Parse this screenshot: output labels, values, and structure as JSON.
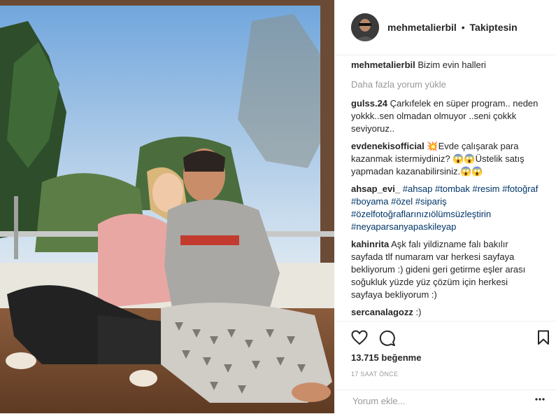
{
  "post": {
    "username": "mehmetalierbil",
    "separator": "•",
    "follow_status": "Takiptesin",
    "caption": "Bizim evin halleri",
    "load_more": "Daha fazla yorum yükle",
    "likes": "13.715 beğenme",
    "time": "17 SAAT ÖNCE",
    "comment_placeholder": "Yorum ekle..."
  },
  "comments": [
    {
      "user": "gulss.24",
      "text": "Çarkıfelek en süper program.. neden yokkk..sen olmadan olmuyor ..seni çokkk seviyoruz.."
    },
    {
      "user": "evdenekisofficial",
      "text_a": "💥Evde çalışarak para kazanmak istermiydiniz? 😱😱Üstelik satış yapmadan kazanabilirsiniz.😱😱"
    },
    {
      "user": "ahsap_evi_",
      "tags": "#ahsap #tombak #resim #fotoğraf #boyama #özel #sipariş #özelfotoğraflarınızıölümsüzleştirin #neyaparsanyapaskileyap"
    },
    {
      "user": "kahinrita",
      "text": "Aşk falı yildizname falı bakılır sayfada tlf numaram var herkesi sayfaya bekliyorum :) gideni geri getirme eşler arası soğukluk yüzde yüz çözüm için herkesi sayfaya bekliyorum :)"
    },
    {
      "user": "sercanalagozz",
      "text": ":)"
    }
  ],
  "icons": [
    "heart-icon",
    "comment-icon",
    "bookmark-icon",
    "more-icon"
  ]
}
